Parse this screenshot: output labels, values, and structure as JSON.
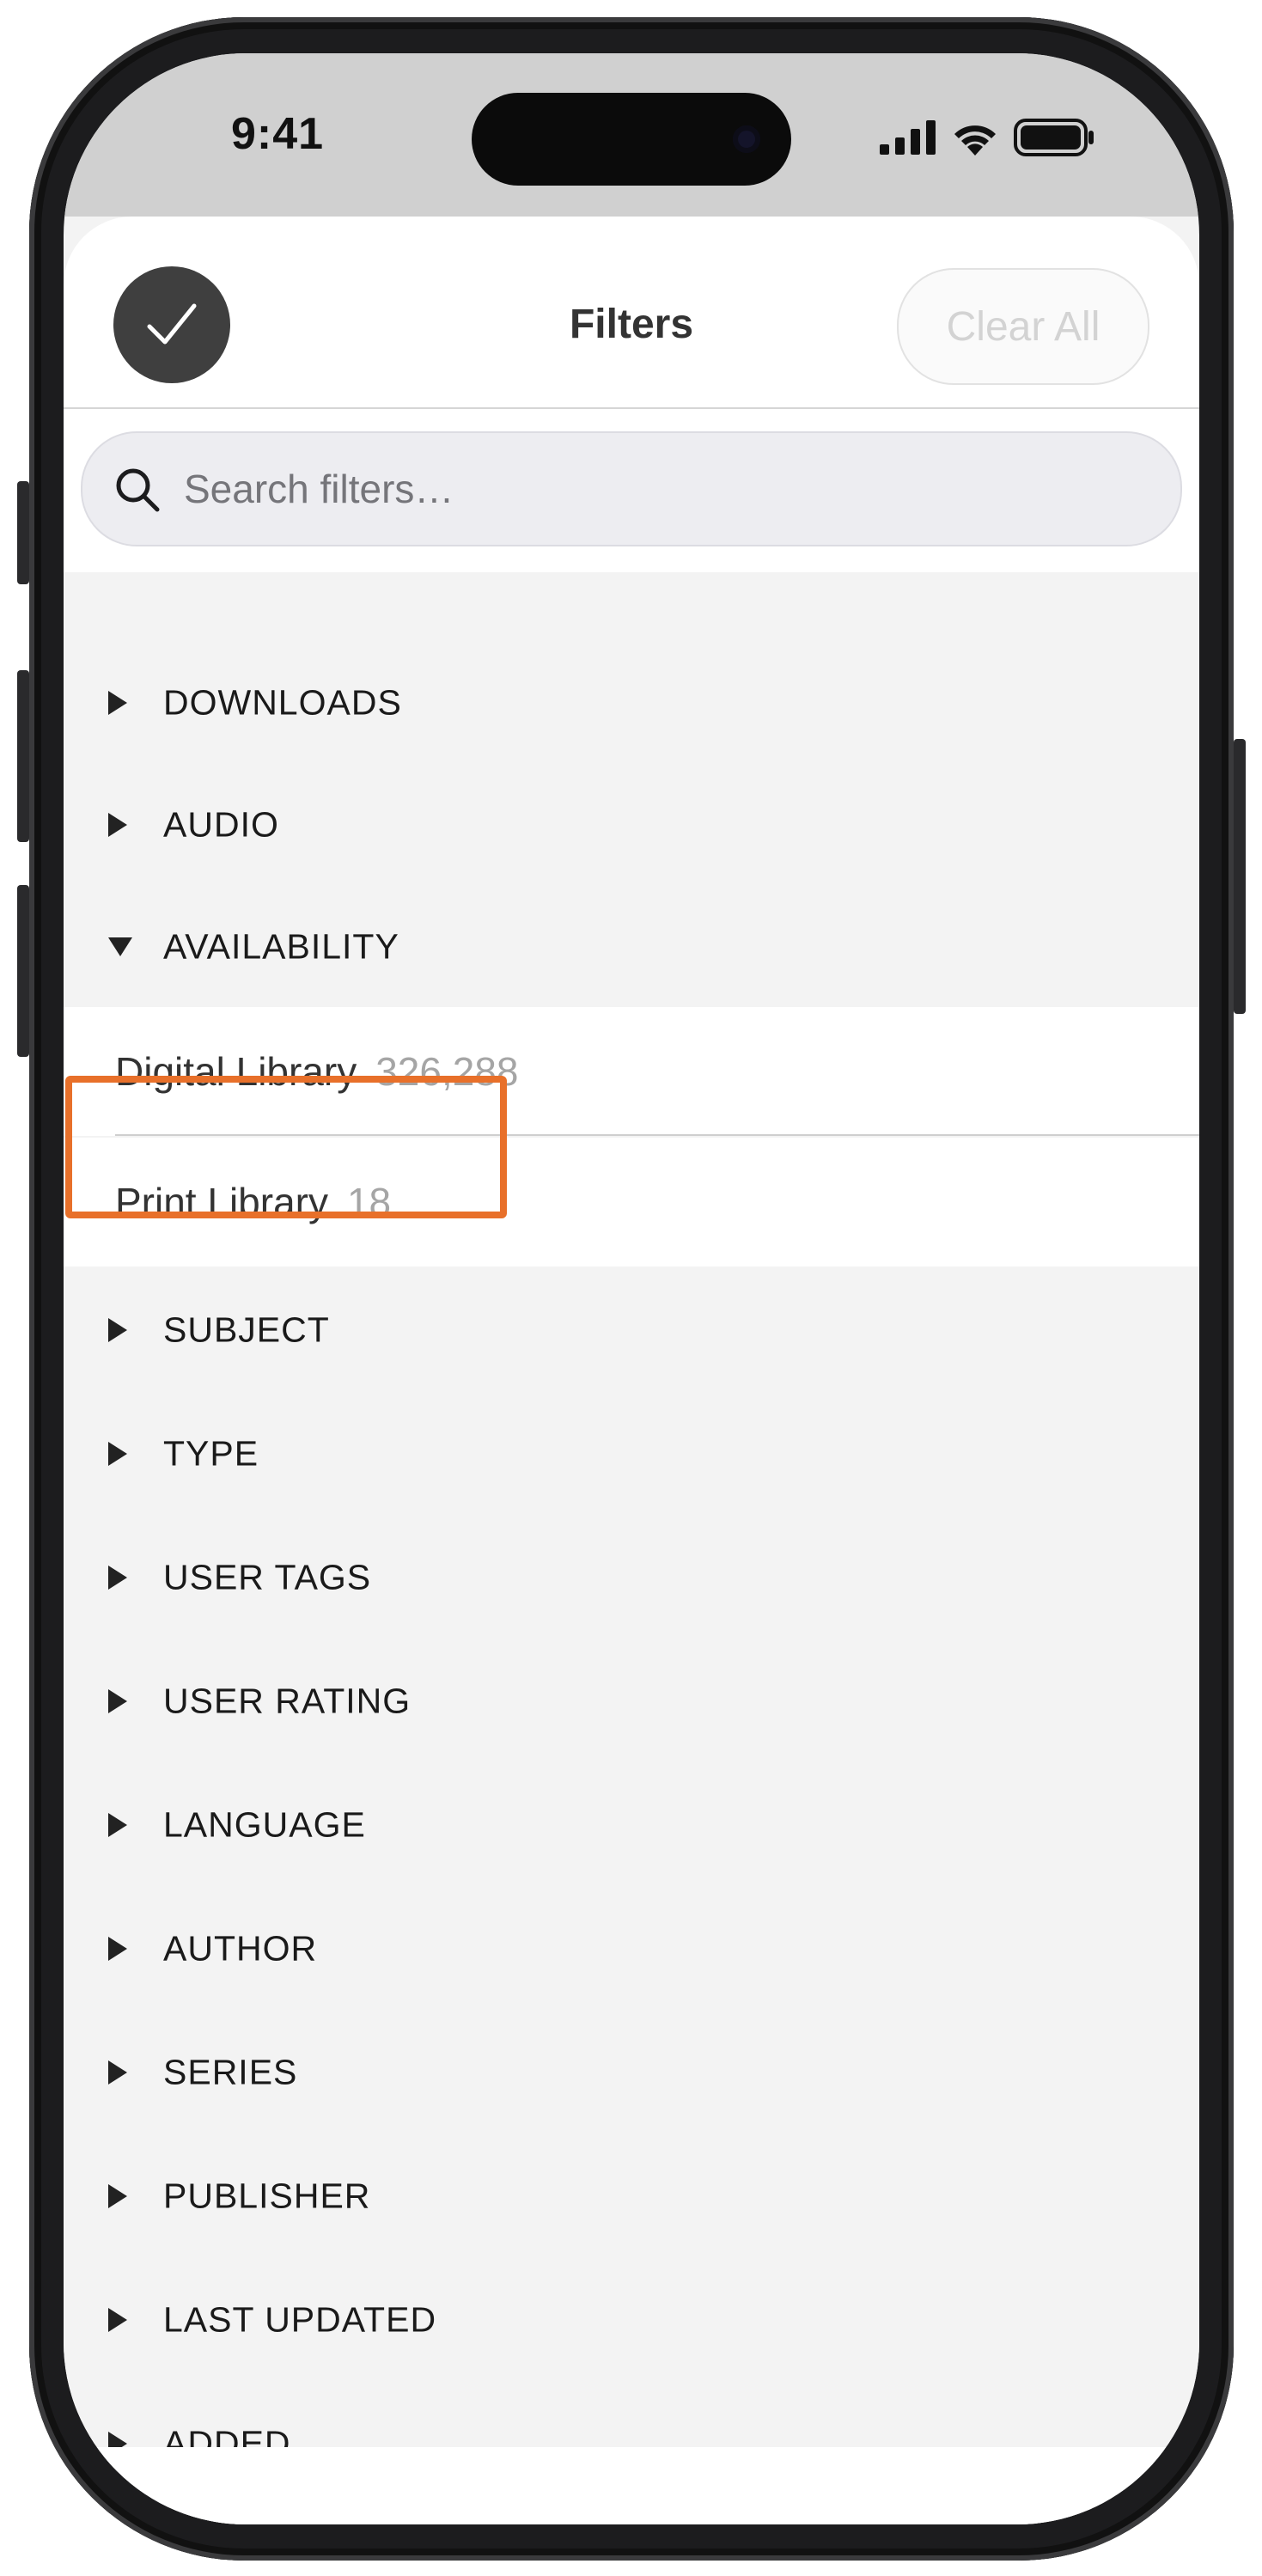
{
  "status_bar": {
    "time": "9:41"
  },
  "header": {
    "title": "Filters",
    "clear_label": "Clear All"
  },
  "search": {
    "placeholder": "Search filters…"
  },
  "categories": [
    {
      "label": "DOWNLOADS",
      "expanded": false
    },
    {
      "label": "AUDIO",
      "expanded": false
    },
    {
      "label": "AVAILABILITY",
      "expanded": true
    },
    {
      "label": "SUBJECT",
      "expanded": false
    },
    {
      "label": "TYPE",
      "expanded": false
    },
    {
      "label": "USER TAGS",
      "expanded": false
    },
    {
      "label": "USER RATING",
      "expanded": false
    },
    {
      "label": "LANGUAGE",
      "expanded": false
    },
    {
      "label": "AUTHOR",
      "expanded": false
    },
    {
      "label": "SERIES",
      "expanded": false
    },
    {
      "label": "PUBLISHER",
      "expanded": false
    },
    {
      "label": "LAST UPDATED",
      "expanded": false
    },
    {
      "label": "ADDED",
      "expanded": false
    }
  ],
  "availability_options": [
    {
      "label": "Digital Library",
      "count": "326,288"
    },
    {
      "label": "Print Library",
      "count": "18",
      "highlighted": true
    }
  ],
  "colors": {
    "highlight": "#e8702a",
    "done_button": "#3f3f3f"
  },
  "icons": {
    "done": "checkmark-icon",
    "search": "search-icon",
    "collapsed": "triangle-right-icon",
    "expanded": "triangle-down-icon"
  }
}
